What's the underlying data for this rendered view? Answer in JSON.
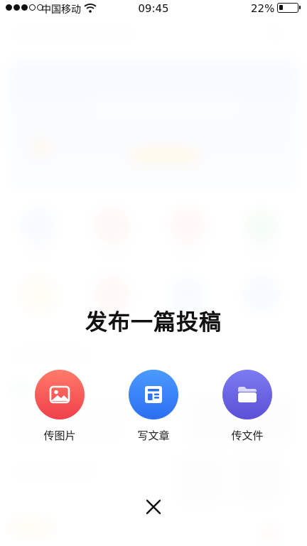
{
  "status_bar": {
    "carrier": "中国移动",
    "time": "09:45",
    "battery_percent": "22%",
    "battery_level": 0.22,
    "signal_bars": 3
  },
  "sheet": {
    "title": "发布一篇投稿",
    "options": [
      {
        "label": "传图片",
        "icon": "image-icon",
        "color_from": "#ff7b6b",
        "color_to": "#f0404a"
      },
      {
        "label": "写文章",
        "icon": "article-icon",
        "color_from": "#4a9bff",
        "color_to": "#2c6ef2"
      },
      {
        "label": "传文件",
        "icon": "folder-icon",
        "color_from": "#7c7cf2",
        "color_to": "#5b4fd6"
      }
    ],
    "close_icon": "close-icon"
  }
}
